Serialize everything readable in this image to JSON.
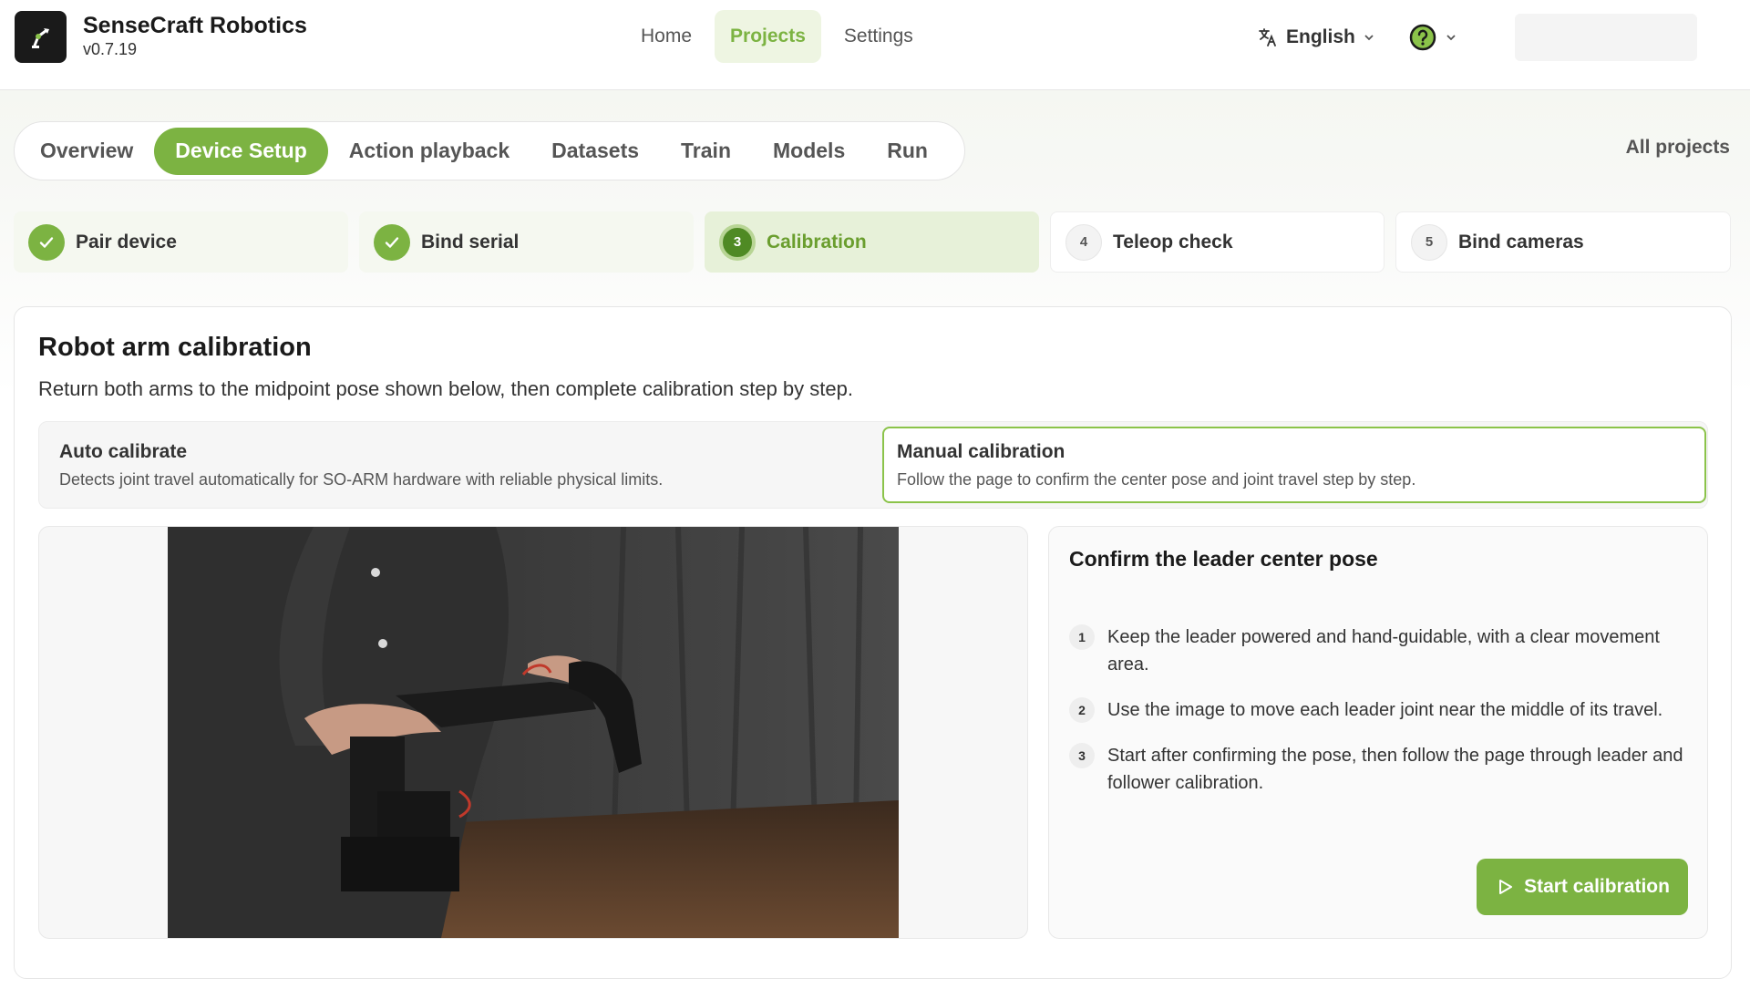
{
  "brand": {
    "name": "SenseCraft Robotics",
    "version": "v0.7.19",
    "logo_icon": "robot-arm-icon"
  },
  "nav": {
    "items": [
      {
        "label": "Home",
        "active": false
      },
      {
        "label": "Projects",
        "active": true
      },
      {
        "label": "Settings",
        "active": false
      }
    ],
    "language": "English",
    "language_icon": "translate-icon",
    "help_icon": "help-circle-icon"
  },
  "tabs": {
    "items": [
      {
        "label": "Overview",
        "active": false
      },
      {
        "label": "Device Setup",
        "active": true
      },
      {
        "label": "Action playback",
        "active": false
      },
      {
        "label": "Datasets",
        "active": false
      },
      {
        "label": "Train",
        "active": false
      },
      {
        "label": "Models",
        "active": false
      },
      {
        "label": "Run",
        "active": false
      }
    ],
    "all_projects": "All projects"
  },
  "steps": [
    {
      "label": "Pair device",
      "status": "done"
    },
    {
      "label": "Bind serial",
      "status": "done"
    },
    {
      "num": "3",
      "label": "Calibration",
      "status": "current"
    },
    {
      "num": "4",
      "label": "Teleop check",
      "status": "todo"
    },
    {
      "num": "5",
      "label": "Bind cameras",
      "status": "todo"
    }
  ],
  "calibration": {
    "title": "Robot arm calibration",
    "subtitle": "Return both arms to the midpoint pose shown below, then complete calibration step by step.",
    "modes": {
      "auto": {
        "title": "Auto calibrate",
        "desc": "Detects joint travel automatically for SO-ARM hardware with reliable physical limits."
      },
      "manual": {
        "title": "Manual calibration",
        "desc": "Follow the page to confirm the center pose and joint travel step by step.",
        "selected": true
      }
    },
    "panel": {
      "title": "Confirm the leader center pose",
      "items": [
        {
          "num": "1",
          "text": "Keep the leader powered and hand-guidable, with a clear movement area."
        },
        {
          "num": "2",
          "text": "Use the image to move each leader joint near the middle of its travel."
        },
        {
          "num": "3",
          "text": "Start after confirming the pose, then follow the page through leader and follower calibration."
        }
      ],
      "start_label": "Start calibration"
    }
  },
  "colors": {
    "accent": "#7cb342",
    "accent_light": "#e7f1d9",
    "text": "#1f1f1f"
  }
}
